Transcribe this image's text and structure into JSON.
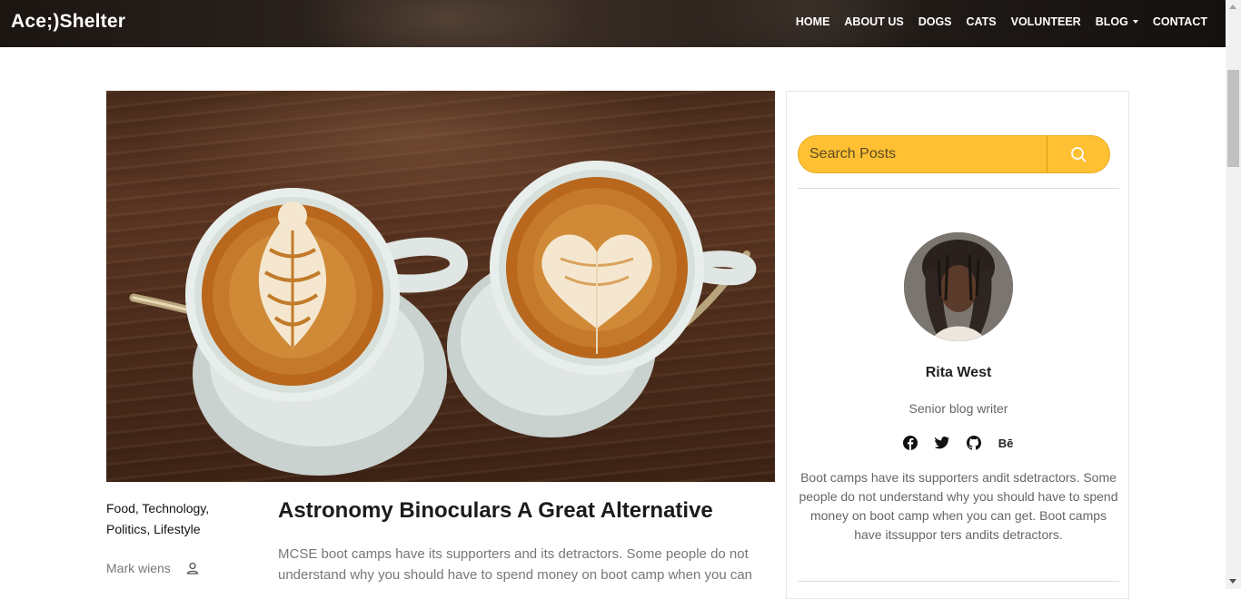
{
  "header": {
    "brand": "Ace;)Shelter",
    "nav": [
      "HOME",
      "ABOUT US",
      "DOGS",
      "CATS",
      "VOLUNTEER",
      "BLOG",
      "CONTACT"
    ]
  },
  "post": {
    "categories_line1": "Food, Technology,",
    "categories_line2": "Politics, Lifestyle",
    "author": "Mark wiens",
    "title": "Astronomy Binoculars A Great Alternative",
    "excerpt": "MCSE boot camps have its supporters and its detractors. Some people do not understand why you should have to spend money on boot camp when you can"
  },
  "sidebar": {
    "search_placeholder": "Search Posts",
    "writer_name": "Rita West",
    "writer_role": "Senior blog writer",
    "social": [
      "facebook-icon",
      "twitter-icon",
      "github-icon",
      "behance-icon"
    ],
    "behance_label": "Bē",
    "bio": "Boot camps have its supporters andit sdetractors. Some people do not understand why you should have to spend money on boot camp when you can get. Boot camps have itssuppor ters andits detractors."
  },
  "colors": {
    "accent": "#ffc033",
    "heading": "#1b1b1b",
    "muted": "#777777"
  }
}
